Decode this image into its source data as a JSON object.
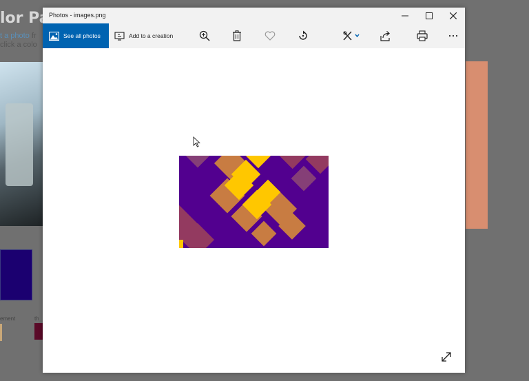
{
  "background_app": {
    "title_fragment": "lor Pa",
    "line1_link": "t a photo",
    "line1_rest": " fr",
    "line2": " click a colo",
    "label_left": "ement",
    "label_right": "th"
  },
  "window": {
    "title": "Photos - images.png"
  },
  "toolbar": {
    "see_all_label": "See all photos",
    "add_to_creation_label": "Add to a creation"
  },
  "icons": {
    "see_all": "photo-gallery-icon",
    "add_to_creation": "creation-icon",
    "zoom": "zoom-in-icon",
    "delete": "trash-icon",
    "favorite": "heart-icon",
    "rotate": "rotate-icon",
    "edit": "edit-draw-icon",
    "share": "share-icon",
    "print": "print-icon",
    "more": "more-icon",
    "minimize": "minimize-icon",
    "maximize": "maximize-icon",
    "close": "close-icon",
    "fullscreen": "expand-icon"
  },
  "colors": {
    "accent": "#0063b1",
    "photo_purple": "#52008f",
    "photo_yellow": "#ffc700",
    "photo_orange": "#e09a28",
    "photo_mauve": "#8f4a73"
  }
}
